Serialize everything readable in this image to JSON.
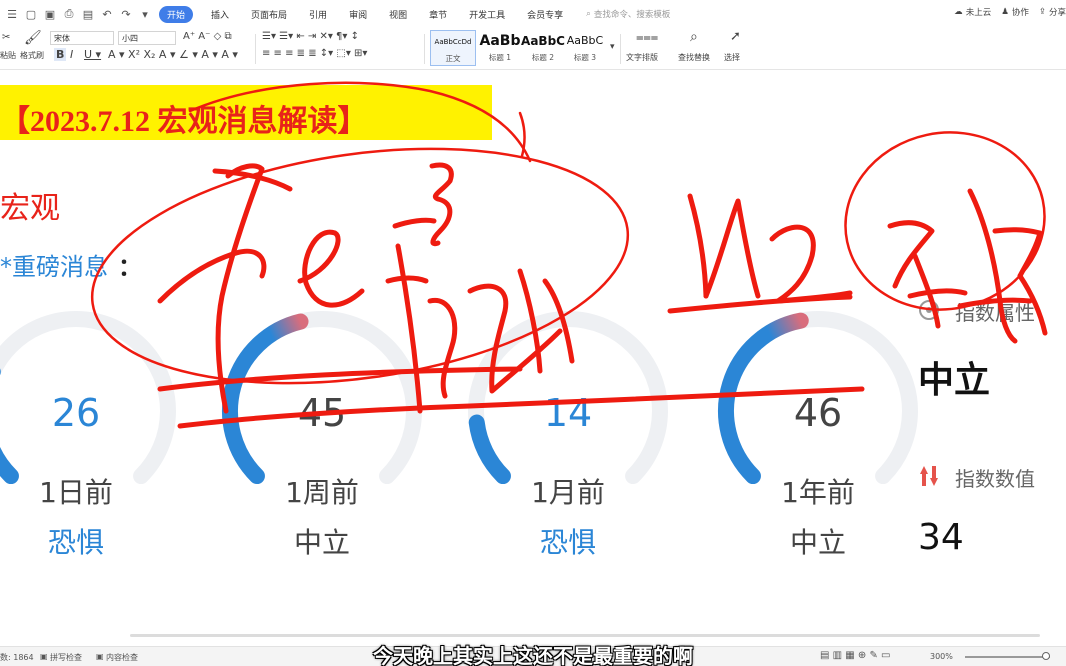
{
  "topbar": {
    "tabs": [
      "开始",
      "插入",
      "页面布局",
      "引用",
      "审阅",
      "视图",
      "章节",
      "开发工具",
      "会员专享"
    ],
    "search_placeholder": "查找命令、搜索模板",
    "cloud_label": "未上云",
    "collab_label": "协作",
    "share_label": "分享"
  },
  "ribbon": {
    "paste_label": "粘贴",
    "format_painter_label": "格式刷",
    "font_name": "宋体",
    "font_size": "小四",
    "styles": [
      {
        "sample": "AaBbCcDd",
        "name": "正文"
      },
      {
        "sample": "AaBb",
        "name": "标题 1"
      },
      {
        "sample": "AaBbC",
        "name": "标题 2"
      },
      {
        "sample": "AaBbC",
        "name": "标题 3"
      }
    ],
    "text_layout_label": "文字排版",
    "find_replace_label": "查找替换",
    "select_label": "选择"
  },
  "document": {
    "title": "【2023.7.12 宏观消息解读】",
    "heading_macro": "宏观",
    "heading_news": "*重磅消息",
    "heading_colon": "：",
    "gauges": [
      {
        "value": "26",
        "period": "1日前",
        "sentiment": "恐惧",
        "level": 0.26
      },
      {
        "value": "45",
        "period": "1周前",
        "sentiment": "中立",
        "level": 0.45
      },
      {
        "value": "14",
        "period": "1月前",
        "sentiment": "恐惧",
        "level": 0.14
      },
      {
        "value": "46",
        "period": "1年前",
        "sentiment": "中立",
        "level": 0.46
      }
    ],
    "panel": {
      "label_1": "指数属性",
      "value_1": "中立",
      "label_2": "指数数值",
      "value_2": "34"
    }
  },
  "statusbar": {
    "word_count": "数: 1864",
    "spell_check": "拼写检查",
    "content_check": "内容检查",
    "zoom": "300%"
  },
  "subtitle": "今天晚上其实上这还不是最重要的啊",
  "colors": {
    "accent_blue": "#2b86d6",
    "title_red": "#e8231a",
    "banner_yellow": "#fff200",
    "ink_red": "#ee1b10"
  }
}
